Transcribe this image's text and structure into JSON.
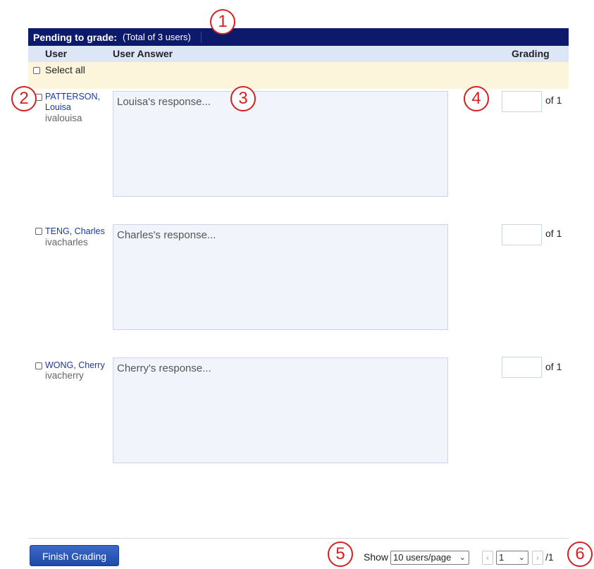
{
  "header": {
    "title": "Pending to grade:",
    "total": "(Total of 3 users)"
  },
  "columns": {
    "user": "User",
    "answer": "User Answer",
    "grading": "Grading"
  },
  "select_all_label": "Select all",
  "users": [
    {
      "name_line1": "PATTERSON,",
      "name_line2": "Louisa",
      "username": "ivalouisa",
      "answer": "Louisa's response...",
      "grade": "",
      "out_of": "of 1"
    },
    {
      "name_line1": "TENG, Charles",
      "name_line2": "",
      "username": "ivacharles",
      "answer": "Charles's response...",
      "grade": "",
      "out_of": "of 1"
    },
    {
      "name_line1": "WONG, Cherry",
      "name_line2": "",
      "username": "ivacherry",
      "answer": "Cherry's response...",
      "grade": "",
      "out_of": "of 1"
    }
  ],
  "footer": {
    "finish_button": "Finish Grading",
    "show_label": "Show",
    "page_size": "10 users/page",
    "prev": "‹",
    "next": "›",
    "current_page": "1",
    "total_pages": "/1"
  },
  "callouts": [
    "1",
    "2",
    "3",
    "4",
    "5",
    "6"
  ],
  "colors": {
    "header_bg": "#0d1a6b",
    "column_header_bg": "#dde6f7",
    "select_row_bg": "#fdf4dc",
    "answer_bg": "#f1f5fb",
    "link": "#1a3a9e",
    "button": "#2a55b8",
    "callout": "#d61f1f"
  }
}
